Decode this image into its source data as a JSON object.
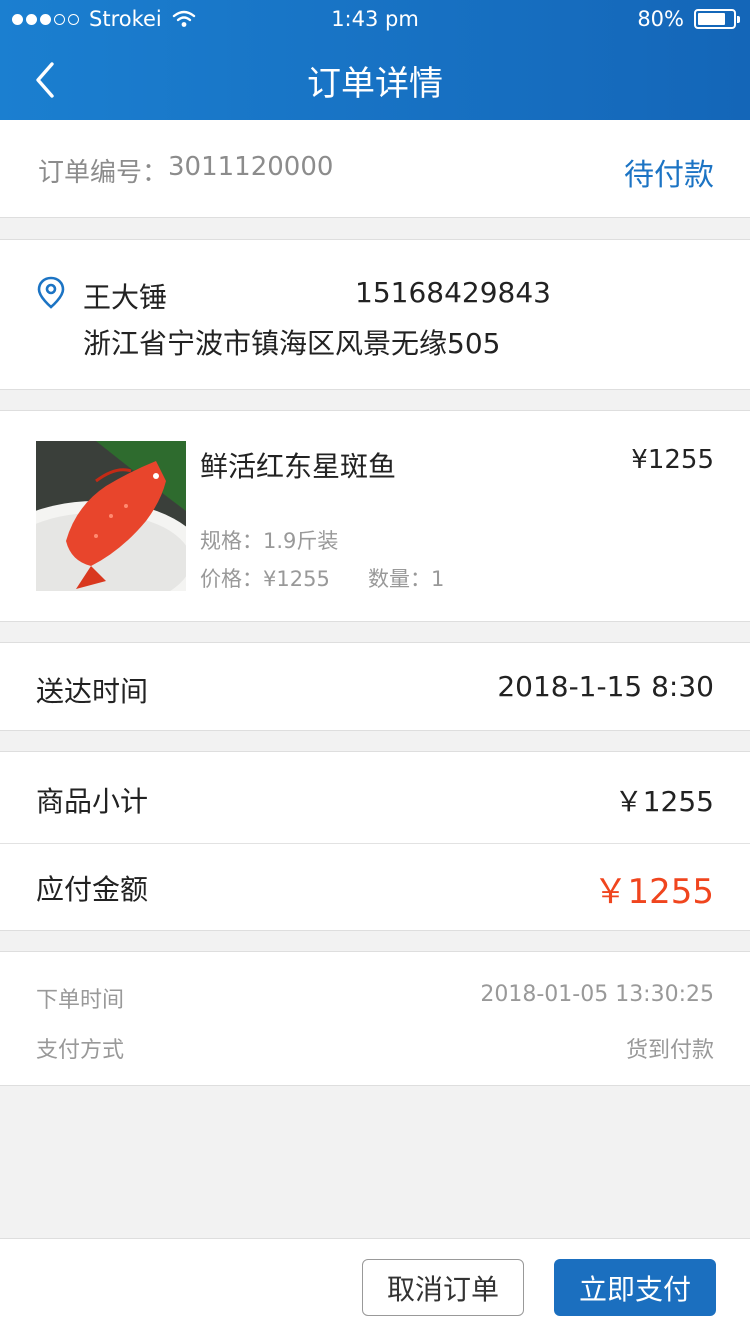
{
  "status_bar": {
    "carrier": "Strokei",
    "time": "1:43 pm",
    "battery": "80%"
  },
  "nav": {
    "title": "订单详情",
    "back_icon": "chevron-left-icon"
  },
  "order": {
    "number_label": "订单编号：",
    "number": "3011120000",
    "status": "待付款"
  },
  "address": {
    "name": "王大锤",
    "phone": "15168429843",
    "detail": "浙江省宁波市镇海区风景无缘505",
    "icon": "location-pin-icon"
  },
  "product": {
    "name": "鲜活红东星斑鱼",
    "price": "¥1255",
    "spec": "规格：1.9斤装",
    "unit_price": "价格：¥1255",
    "quantity": "数量：1"
  },
  "delivery": {
    "label": "送达时间",
    "value": "2018-1-15  8:30"
  },
  "totals": {
    "subtotal_label": "商品小计",
    "subtotal_value": "￥1255",
    "payable_label": "应付金额",
    "payable_value": "￥1255"
  },
  "meta": {
    "order_time_label": "下单时间",
    "order_time_value": "2018-01-05   13:30:25",
    "payment_label": "支付方式",
    "payment_value": "货到付款"
  },
  "actions": {
    "cancel_label": "取消订单",
    "pay_label": "立即支付"
  },
  "colors": {
    "brand_blue": "#1b6fbf",
    "status_blue": "#1c74c4",
    "price_red": "#f0451e"
  }
}
